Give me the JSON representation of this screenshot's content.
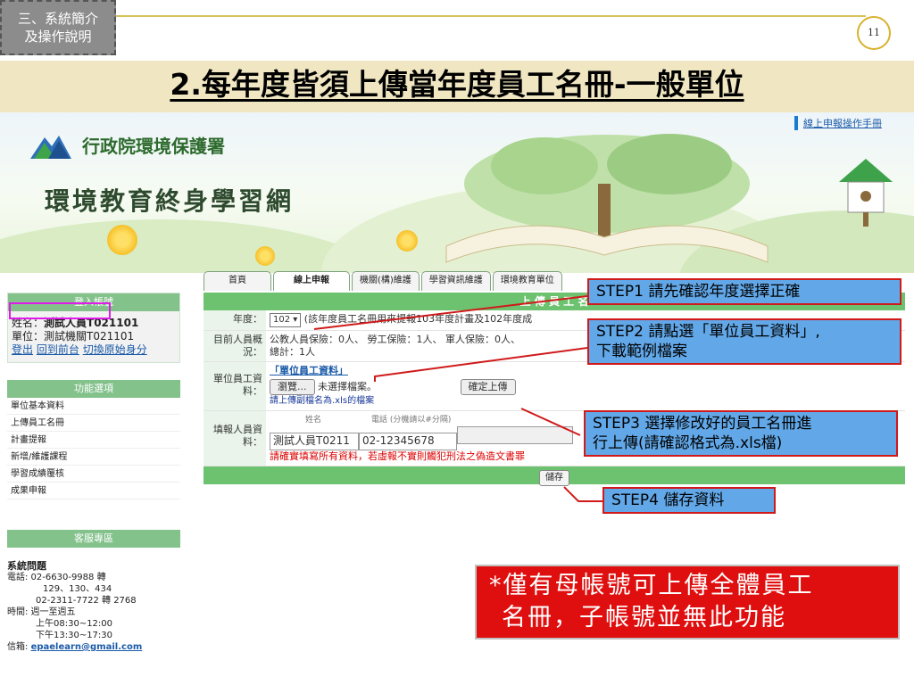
{
  "slide": {
    "section_tag_line1": "三、系統簡介",
    "section_tag_line2": "及操作說明",
    "page_number": "11",
    "title": "2.每年度皆須上傳當年度員工名冊-一般單位"
  },
  "site": {
    "org_name": "行政院環境保護署",
    "site_name": "環境教育終身學習網",
    "manual_link": "線上申報操作手冊",
    "tabs": [
      "首頁",
      "線上申報",
      "機關(構)維護",
      "學習資訊維護",
      "環境教育單位"
    ]
  },
  "sidebar": {
    "login_header": "登入帳號",
    "name_label": "姓名：",
    "name_value": "測試人員T021101",
    "unit_label": "單位：",
    "unit_value": "測試機關T021101",
    "links": [
      "登出",
      "回到前台",
      "切換原始身分"
    ],
    "menu_header": "功能選項",
    "menu_items": [
      "單位基本資料",
      "上傳員工名冊",
      "計畫提報",
      "新增/維護課程",
      "學習成績覆核",
      "成果申報"
    ],
    "service_header": "客服專區",
    "contact_title": "系統問題",
    "contact_phone1": "電話: 02-6630-9988 轉",
    "contact_phone1_ext": "129、130、434",
    "contact_phone2": "02-2311-7722 轉 2768",
    "contact_time": "時間: 週一至週五",
    "contact_am": "上午08:30~12:00",
    "contact_pm": "下午13:30~17:30",
    "contact_mail_label": "信箱: ",
    "contact_mail": "epaelearn@gmail.com"
  },
  "form": {
    "header": "上 傳 員 工 名",
    "year_label": "年度：",
    "year_value": "102",
    "year_note": "(該年度員工名冊用來提報103年度計畫及102年度成",
    "staff_label": "目前人員概況：",
    "staff_text": "公教人員保險：0人、 勞工保險：1人、 軍人保險：0人、",
    "staff_total": "總計：1人",
    "file_label": "單位員工資料：",
    "file_link": "「單位員工資料」",
    "browse_button": "瀏覽...",
    "file_status": "未選擇檔案。",
    "upload_button": "確定上傳",
    "file_hint": "請上傳副檔名為.xls的檔案",
    "filler_label": "填報人員資料：",
    "col_name": "姓名",
    "col_phone": "電話 (分機請以#分隔)",
    "filler_name": "測試人員T0211",
    "filler_phone": "02-12345678",
    "warning": "請確實填寫所有資料，若虛報不實則觸犯刑法之偽造文書罪",
    "save_button": "儲存"
  },
  "callouts": {
    "step1": "STEP1 請先確認年度選擇正確",
    "step2_line1": "STEP2  請點選「單位員工資料」,",
    "step2_line2": "下載範例檔案",
    "step3_line1": "STEP3  選擇修改好的員工名冊進",
    "step3_line2": "行上傳(請確認格式為.xls檔)",
    "step4": "STEP4 儲存資料",
    "note_line1": "*僅有母帳號可上傳全體員工",
    "note_line2": "名冊，子帳號並無此功能"
  },
  "colors": {
    "callout_bg": "#62a8e8",
    "callout_border": "#d01a1a",
    "note_bg": "#e00f0f",
    "form_green": "#6cc26e",
    "menu_highlight": "#e01ae8"
  }
}
